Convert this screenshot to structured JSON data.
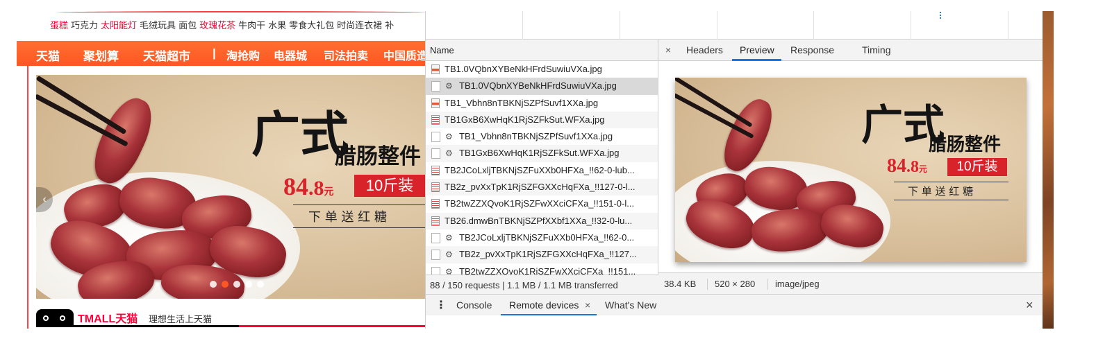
{
  "tmall": {
    "hot_words": [
      {
        "text": "蛋糕",
        "red": true
      },
      {
        "text": "巧克力",
        "red": false
      },
      {
        "text": "太阳能灯",
        "red": true
      },
      {
        "text": "毛绒玩具",
        "red": false
      },
      {
        "text": "面包",
        "red": false
      },
      {
        "text": "玫瑰花茶",
        "red": true
      },
      {
        "text": "牛肉干",
        "red": false
      },
      {
        "text": "水果",
        "red": false
      },
      {
        "text": "零食大礼包",
        "red": false
      },
      {
        "text": "时尚连衣裙",
        "red": false
      },
      {
        "text": "补",
        "red": false
      }
    ],
    "nav": [
      "天猫",
      "聚划算",
      "天猫超市",
      "|",
      "淘抢购",
      "电器城",
      "司法拍卖",
      "中国质造"
    ],
    "banner": {
      "title_big": "广式",
      "title_small": "腊肠整件",
      "price_int": "84",
      "price_dec": ".8",
      "price_unit": "元",
      "tag": "10斤装",
      "sub": "下 单 送 红 糖",
      "prev_icon": "chevron-left-icon",
      "prev_glyph": "‹"
    },
    "carousel": {
      "count": 5,
      "active": 1
    },
    "brand": {
      "logo_text": "TMALL天猫",
      "slogan": "理想生活上天猫"
    },
    "colors": {
      "nav": "#ff5722",
      "brand": "#ff0036",
      "price": "#d8232a"
    }
  },
  "devtools": {
    "list_header": "Name",
    "requests": [
      {
        "name": "TB1.0VQbnXYBeNkHFrdSuwiuVXa.jpg",
        "icon": "image",
        "indent": false
      },
      {
        "name": "TB1.0VQbnXYBeNkHFrdSuwiuVXa.jpg",
        "icon": "gear",
        "indent": true,
        "selected": true
      },
      {
        "name": "TB1_Vbhn8nTBKNjSZPfSuvf1XXa.jpg",
        "icon": "image",
        "indent": false
      },
      {
        "name": "TB1GxB6XwHqK1RjSZFkSut.WFXa.jpg",
        "icon": "doc",
        "indent": false
      },
      {
        "name": "TB1_Vbhn8nTBKNjSZPfSuvf1XXa.jpg",
        "icon": "gear",
        "indent": true
      },
      {
        "name": "TB1GxB6XwHqK1RjSZFkSut.WFXa.jpg",
        "icon": "gear",
        "indent": true
      },
      {
        "name": "TB2JCoLxljTBKNjSZFuXXb0HFXa_!!62-0-lub...",
        "icon": "doc",
        "indent": false
      },
      {
        "name": "TB2z_pvXxTpK1RjSZFGXXcHqFXa_!!127-0-l...",
        "icon": "doc",
        "indent": false
      },
      {
        "name": "TB2twZZXQvoK1RjSZFwXXciCFXa_!!151-0-l...",
        "icon": "doc",
        "indent": false
      },
      {
        "name": "TB26.dmwBnTBKNjSZPfXXbf1XXa_!!32-0-lu...",
        "icon": "doc",
        "indent": false
      },
      {
        "name": "TB2JCoLxljTBKNjSZFuXXb0HFXa_!!62-0...",
        "icon": "gear",
        "indent": true
      },
      {
        "name": "TB2z_pvXxTpK1RjSZFGXXcHqFXa_!!127...",
        "icon": "gear",
        "indent": true
      },
      {
        "name": "TB2twZZXQvoK1RjSZFwXXciCFXa_!!151...",
        "icon": "gear",
        "indent": true
      }
    ],
    "list_status": "88 / 150 requests | 1.1 MB / 1.1 MB transferred",
    "tabs": {
      "close": "×",
      "items": [
        "Headers",
        "Preview",
        "Response",
        "Timing"
      ],
      "active": "Preview"
    },
    "preview_status": {
      "size": "38.4 KB",
      "dims": "520 × 280",
      "type": "image/jpeg"
    },
    "drawer": {
      "menu": "⋮",
      "tabs": [
        "Console",
        "Remote devices",
        "What's New"
      ],
      "active": "Remote devices",
      "tab_close": "×",
      "close": "×"
    },
    "colors": {
      "accent": "#1a73e8",
      "selected_row": "#d9d9d9"
    }
  }
}
